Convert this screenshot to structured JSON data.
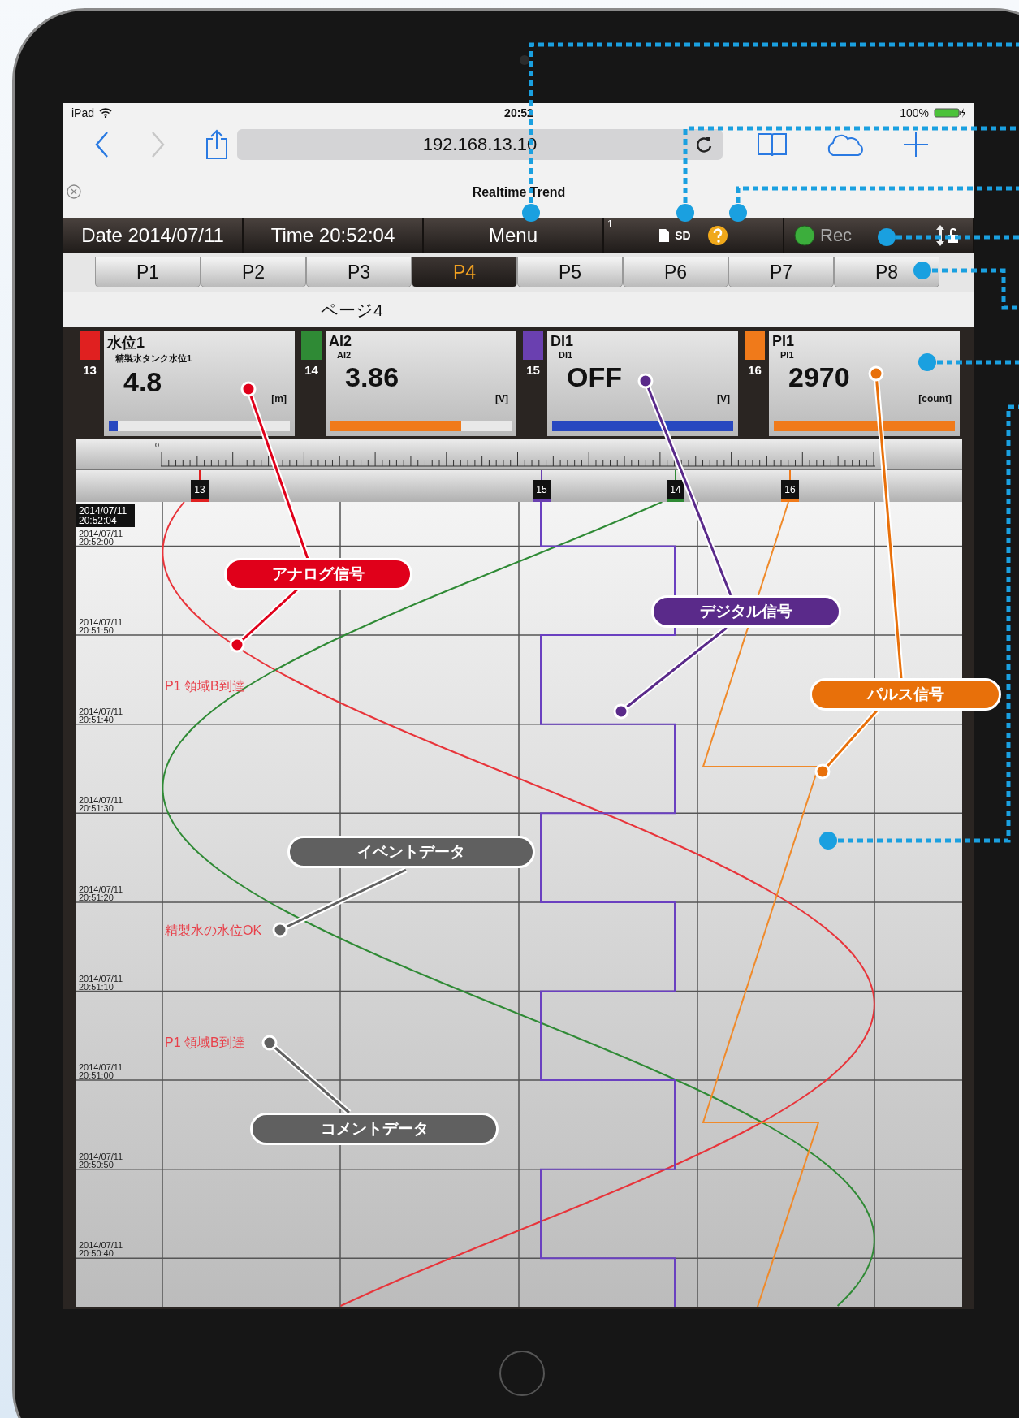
{
  "status_bar": {
    "device": "iPad",
    "time": "20:52",
    "battery": "100%"
  },
  "browser": {
    "nav": [
      {
        "kind": "back",
        "disabled": false
      },
      {
        "kind": "forward",
        "disabled": true
      }
    ],
    "url": "192.168.13.10",
    "page_title": "Realtime Trend"
  },
  "toolbar": {
    "date": "Date 2014/07/11",
    "time": "Time 20:52:04",
    "menu": "Menu",
    "counter": "1",
    "sd": "SD",
    "rec": "Rec"
  },
  "tabs": [
    {
      "label": "P1",
      "selected": false
    },
    {
      "label": "P2",
      "selected": false
    },
    {
      "label": "P3",
      "selected": false
    },
    {
      "label": "P4",
      "selected": true
    },
    {
      "label": "P5",
      "selected": false
    },
    {
      "label": "P6",
      "selected": false
    },
    {
      "label": "P7",
      "selected": false
    },
    {
      "label": "P8",
      "selected": false
    }
  ],
  "page_title": "ページ4",
  "channels": [
    {
      "number": "13",
      "name": "水位1",
      "subname": "精製水タンク水位1",
      "value": "4.8",
      "unit": "[m]",
      "color": "#e02020",
      "bar": {
        "color": "#2848c0",
        "level": 0.05
      }
    },
    {
      "number": "14",
      "name": "AI2",
      "subname": "AI2",
      "value": "3.86",
      "unit": "[V]",
      "color": "#2f8a35",
      "bar": {
        "color": "#f07a1a",
        "level": 0.72
      }
    },
    {
      "number": "15",
      "name": "DI1",
      "subname": "DI1",
      "value": "OFF",
      "unit": "[V]",
      "color": "#6a40b0",
      "bar": {
        "color": "#2848c0",
        "level": 1
      }
    },
    {
      "number": "16",
      "name": "PI1",
      "subname": "PI1",
      "value": "2970",
      "unit": "[count]",
      "color": "#f07a1a",
      "bar": {
        "color": "#f07a1a",
        "level": 1
      }
    }
  ],
  "ruler": {
    "start": "0"
  },
  "chart": {
    "current_time": {
      "date": "2014/07/11",
      "time": "20:52:04"
    },
    "markers": [
      {
        "number": "13",
        "color": "#e02020"
      },
      {
        "number": "15",
        "color": "#6a40b0"
      },
      {
        "number": "14",
        "color": "#2f8a35"
      },
      {
        "number": "16",
        "color": "#f07a1a"
      }
    ],
    "time_labels": [
      {
        "date": "2014/07/11",
        "time": "20:52:00"
      },
      {
        "date": "2014/07/11",
        "time": "20:51:50"
      },
      {
        "date": "2014/07/11",
        "time": "20:51:40"
      },
      {
        "date": "2014/07/11",
        "time": "20:51:30"
      },
      {
        "date": "2014/07/11",
        "time": "20:51:20"
      },
      {
        "date": "2014/07/11",
        "time": "20:51:10"
      },
      {
        "date": "2014/07/11",
        "time": "20:51:00"
      },
      {
        "date": "2014/07/11",
        "time": "20:50:50"
      },
      {
        "date": "2014/07/11",
        "time": "20:50:40"
      }
    ],
    "events": [
      {
        "text": "P1 領域B到達"
      },
      {
        "text": "精製水の水位OK"
      },
      {
        "text": "P1 領域B到達"
      }
    ]
  },
  "callouts": [
    {
      "text": "アナログ信号",
      "color": "#e0001a"
    },
    {
      "text": "デジタル信号",
      "color": "#5a2a8a"
    },
    {
      "text": "パルス信号",
      "color": "#e8700a"
    },
    {
      "text": "イベントデータ",
      "color": "#606060"
    },
    {
      "text": "コメントデータ",
      "color": "#606060"
    }
  ]
}
